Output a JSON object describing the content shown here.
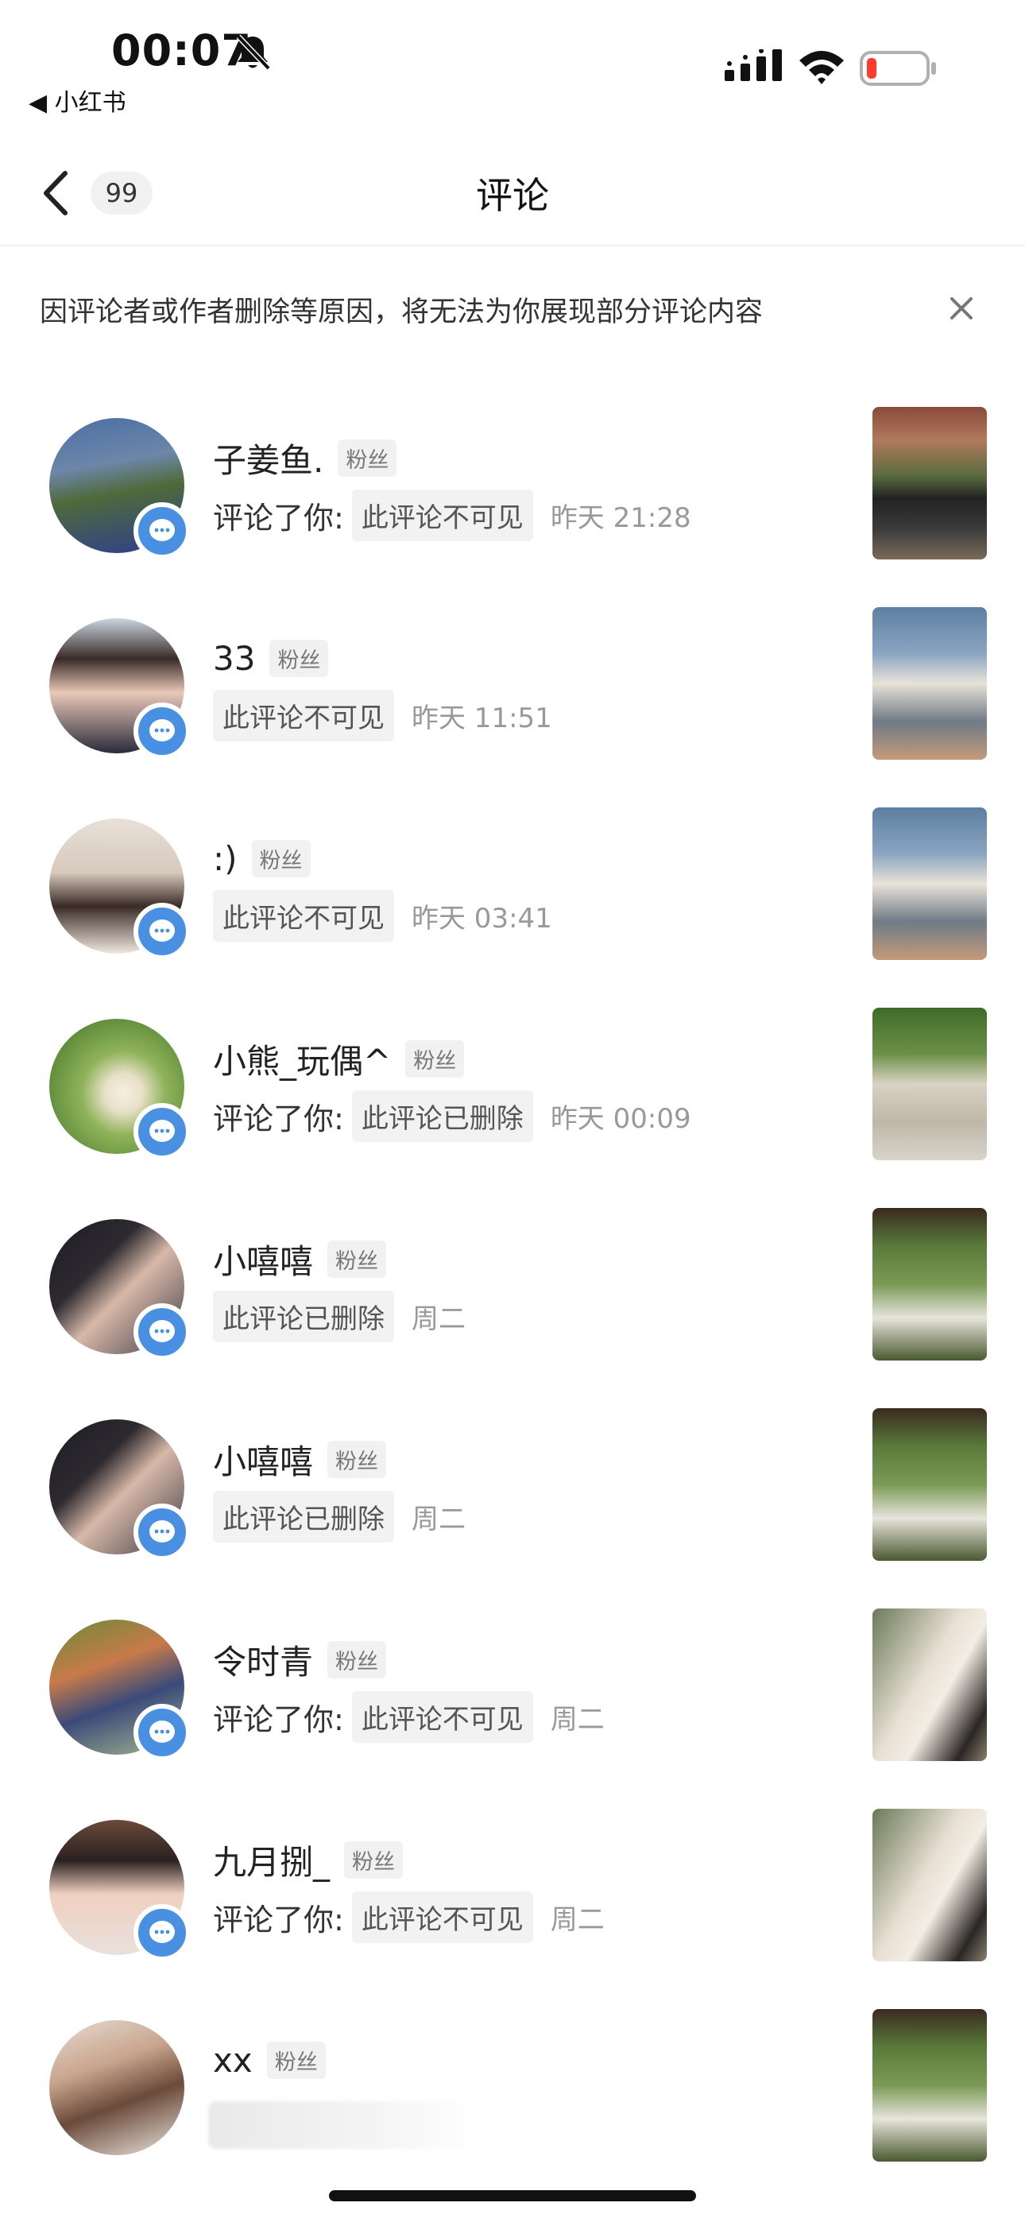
{
  "status_bar": {
    "time": "00:07",
    "back_app": "◀ 小红书",
    "battery_color": "#ff3b30"
  },
  "nav": {
    "badge": "99",
    "title": "评论"
  },
  "notice": {
    "text": "因评论者或作者删除等原因，将无法为你展现部分评论内容"
  },
  "colors": {
    "badge_blue": "#4a90e2",
    "tag_bg": "#f1f1f1"
  },
  "rows": [
    {
      "name": "子姜鱼.",
      "tag": "粉丝",
      "prefix": "评论了你:",
      "chip": "此评论不可见",
      "time": "昨天 21:28"
    },
    {
      "name": "33",
      "tag": "粉丝",
      "prefix": "",
      "chip": "此评论不可见",
      "time": "昨天 11:51"
    },
    {
      "name": ":)",
      "tag": "粉丝",
      "prefix": "",
      "chip": "此评论不可见",
      "time": "昨天 03:41"
    },
    {
      "name": "小熊_玩偶^",
      "tag": "粉丝",
      "prefix": "评论了你:",
      "chip": "此评论已删除",
      "time": "昨天 00:09"
    },
    {
      "name": "小嘻嘻",
      "tag": "粉丝",
      "prefix": "",
      "chip": "此评论已删除",
      "time": "周二"
    },
    {
      "name": "小嘻嘻",
      "tag": "粉丝",
      "prefix": "",
      "chip": "此评论已删除",
      "time": "周二"
    },
    {
      "name": "令时青",
      "tag": "粉丝",
      "prefix": "评论了你:",
      "chip": "此评论不可见",
      "time": "周二"
    },
    {
      "name": "九月捌_",
      "tag": "粉丝",
      "prefix": "评论了你:",
      "chip": "此评论不可见",
      "time": "周二"
    },
    {
      "name": "xx",
      "tag": "粉丝",
      "prefix": "",
      "chip": "",
      "time": ""
    }
  ]
}
